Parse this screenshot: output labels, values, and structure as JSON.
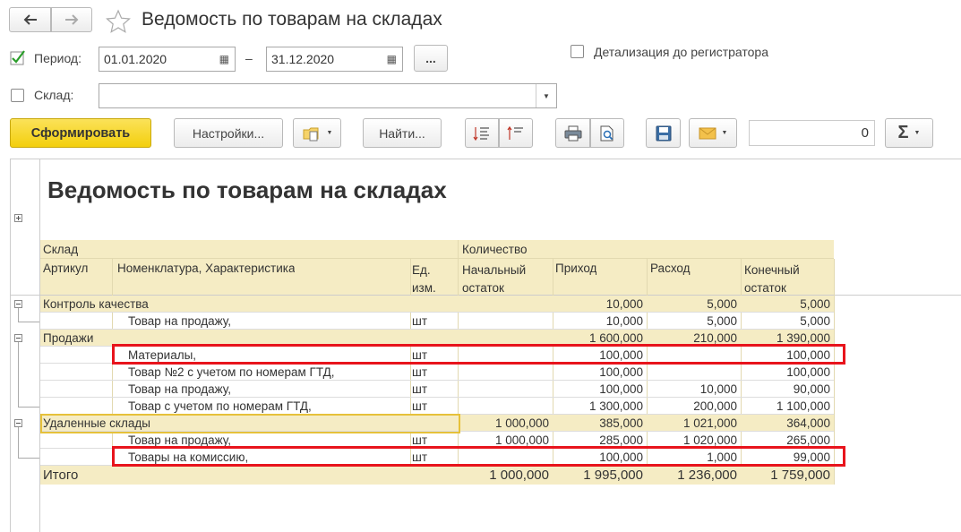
{
  "window": {
    "title": "Ведомость по товарам на складах"
  },
  "filters": {
    "period_label": "Период:",
    "period_checked": true,
    "date_from": "01.01.2020",
    "dash": "–",
    "date_to": "31.12.2020",
    "more_label": "...",
    "detail_label": "Детализация до регистратора",
    "warehouse_label": "Склад:",
    "warehouse_value": ""
  },
  "toolbar": {
    "generate_label": "Сформировать",
    "settings_label": "Настройки...",
    "find_label": "Найти...",
    "counter_value": "0",
    "sigma_label": "Σ"
  },
  "report": {
    "title": "Ведомость по товарам на складах",
    "headers": {
      "warehouse": "Склад",
      "quantity": "Количество",
      "article": "Артикул",
      "nomenclature": "Номенклатура, Характеристика",
      "unit": "Ед. изм.",
      "start": "Начальный остаток",
      "income": "Приход",
      "expense": "Расход",
      "end": "Конечный остаток"
    },
    "rows": [
      {
        "level": 0,
        "name": "Контроль качества",
        "unit": "",
        "start": "",
        "income": "10,000",
        "expense": "5,000",
        "end": "5,000"
      },
      {
        "level": 1,
        "name": "Товар на продажу,",
        "unit": "шт",
        "start": "",
        "income": "10,000",
        "expense": "5,000",
        "end": "5,000"
      },
      {
        "level": 0,
        "name": "Продажи",
        "unit": "",
        "start": "",
        "income": "1 600,000",
        "expense": "210,000",
        "end": "1 390,000"
      },
      {
        "level": 1,
        "name": "Материалы,",
        "unit": "шт",
        "start": "",
        "income": "100,000",
        "expense": "",
        "end": "100,000",
        "highlight": true
      },
      {
        "level": 1,
        "name": "Товар №2 с учетом по номерам ГТД,",
        "unit": "шт",
        "start": "",
        "income": "100,000",
        "expense": "",
        "end": "100,000"
      },
      {
        "level": 1,
        "name": "Товар на продажу,",
        "unit": "шт",
        "start": "",
        "income": "100,000",
        "expense": "10,000",
        "end": "90,000"
      },
      {
        "level": 1,
        "name": "Товар с учетом по номерам ГТД,",
        "unit": "шт",
        "start": "",
        "income": "1 300,000",
        "expense": "200,000",
        "end": "1 100,000"
      },
      {
        "level": 0,
        "name": "Удаленные склады",
        "unit": "",
        "start": "1 000,000",
        "income": "385,000",
        "expense": "1 021,000",
        "end": "364,000",
        "selected": true
      },
      {
        "level": 1,
        "name": "Товар на продажу,",
        "unit": "шт",
        "start": "1 000,000",
        "income": "285,000",
        "expense": "1 020,000",
        "end": "265,000"
      },
      {
        "level": 1,
        "name": "Товары на комиссию,",
        "unit": "шт",
        "start": "",
        "income": "100,000",
        "expense": "1,000",
        "end": "99,000",
        "highlight": true
      }
    ],
    "total": {
      "name": "Итого",
      "start": "1 000,000",
      "income": "1 995,000",
      "expense": "1 236,000",
      "end": "1 759,000"
    }
  },
  "colors": {
    "accent_button": "#f9d71c",
    "header_bg": "#f5ecc4",
    "highlight_border": "#e8141c",
    "selection_border": "#e6c13a",
    "check": "#2a9d2a"
  }
}
